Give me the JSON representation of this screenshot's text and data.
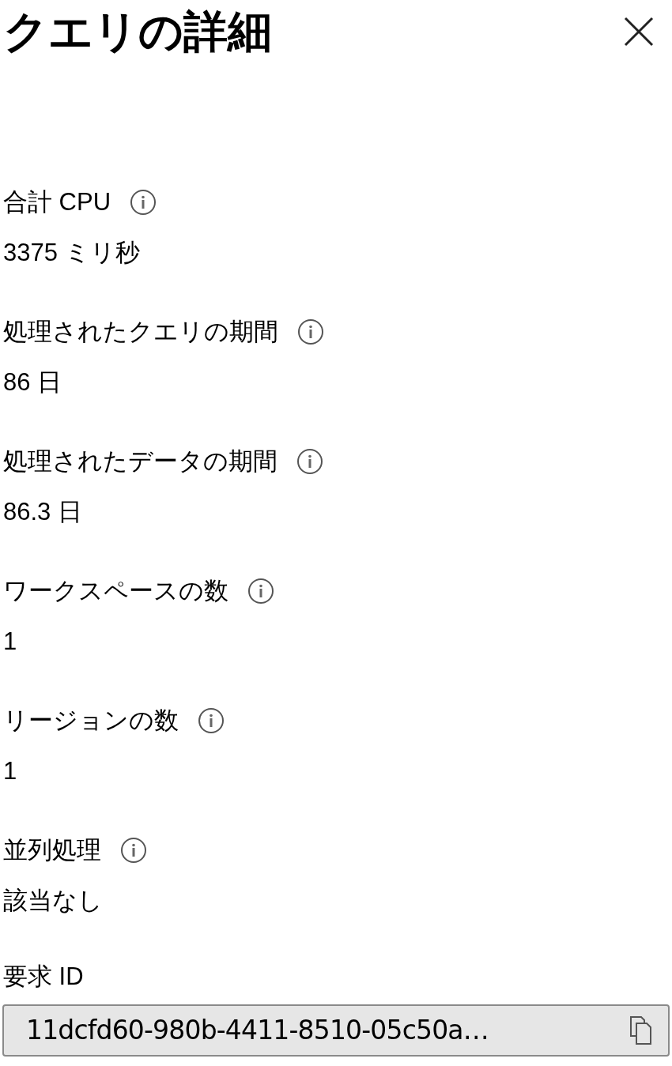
{
  "panel": {
    "title": "クエリの詳細"
  },
  "details": [
    {
      "label": "合計 CPU",
      "info": true,
      "value": "3375 ミリ秒"
    },
    {
      "label": "処理されたクエリの期間",
      "info": true,
      "value": "86 日"
    },
    {
      "label": "処理されたデータの期間",
      "info": true,
      "value": "86.3 日"
    },
    {
      "label": "ワークスペースの数",
      "info": true,
      "value": "1"
    },
    {
      "label": "リージョンの数",
      "info": true,
      "value": "1"
    },
    {
      "label": "並列処理",
      "info": true,
      "value": "該当なし"
    }
  ],
  "request_id": {
    "label": "要求 ID",
    "value": "11dcfd60-980b-4411-8510-05c50a…"
  }
}
